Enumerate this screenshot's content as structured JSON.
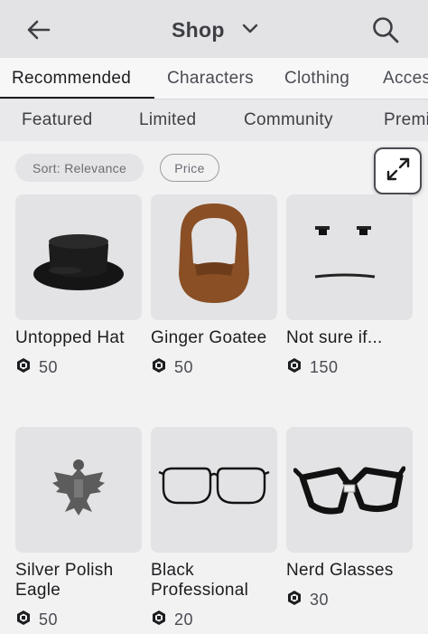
{
  "header": {
    "title": "Shop",
    "back_icon": "back-arrow-icon",
    "dropdown_icon": "chevron-down-icon",
    "search_icon": "search-icon",
    "background": "#e3e3e5"
  },
  "tabs": [
    {
      "label": "Recommended",
      "active": true
    },
    {
      "label": "Characters",
      "active": false
    },
    {
      "label": "Clothing",
      "active": false
    },
    {
      "label": "Accessories",
      "active": false
    }
  ],
  "subtabs": [
    {
      "label": "Featured"
    },
    {
      "label": "Limited"
    },
    {
      "label": "Community"
    },
    {
      "label": "Premium"
    }
  ],
  "filters": {
    "sort_label": "Sort: Relevance",
    "price_label": "Price"
  },
  "items": [
    {
      "name": "Untopped Hat",
      "price": "50",
      "image": "black-hat"
    },
    {
      "name": "Ginger Goatee",
      "price": "50",
      "image": "goatee"
    },
    {
      "name": "Not sure if...",
      "price": "150",
      "image": "face"
    },
    {
      "name": "Silver Polish Eagle",
      "price": "50",
      "image": "eagle"
    },
    {
      "name": "Black Professional",
      "price": "20",
      "image": "glasses"
    },
    {
      "name": "Nerd Glasses",
      "price": "30",
      "image": "nerd-glasses"
    }
  ],
  "colors": {
    "accent": "#1c1d1f",
    "card_bg": "#e3e3e5",
    "page_bg": "#f2f2f3"
  }
}
